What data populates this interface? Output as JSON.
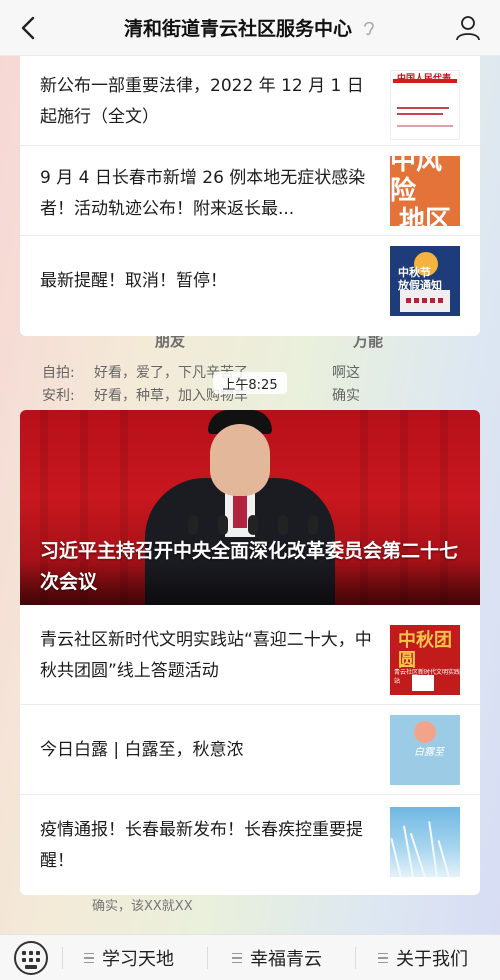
{
  "header": {
    "title": "清和街道青云社区服务中心"
  },
  "background": {
    "col_heads": [
      "朋友",
      "万能"
    ],
    "rows": [
      {
        "label": "自拍:",
        "text": "好看，爱了，下凡辛苦了",
        "right": "啊这"
      },
      {
        "label": "安利:",
        "text": "好看，种草，加入购物车",
        "right": "确实"
      }
    ],
    "bottom_text": "确实，该XX就XX",
    "time": "上午8:25"
  },
  "news_top": [
    {
      "title": "新公布一部重要法律，2022 年 12 月 1 日起施行（全文）",
      "thumb_mast": "中国人民代表",
      "thumb": "document-thumbnail"
    },
    {
      "title": "9 月 4 日长春市新增 26 例本地无症状感染者！活动轨迹公布！附来返长最...",
      "thumb_lines": [
        "中风险",
        "地区"
      ],
      "thumb": "risk-area-thumbnail"
    },
    {
      "title": "最新提醒！取消！暂停！",
      "thumb_lines": [
        "中秋节",
        "放假通知"
      ],
      "thumb": "mid-autumn-notice-thumbnail"
    }
  ],
  "hero": {
    "title": "习近平主持召开中央全面深化改革委员会第二十七次会议"
  },
  "news_bottom": [
    {
      "title": "青云社区新时代文明实践站“喜迎二十大，中秋共团圆”线上答题活动",
      "thumb_text": "中秋团圆",
      "thumb_sub": "青云社区新时代文明实践站",
      "thumb": "mid-autumn-quiz-thumbnail"
    },
    {
      "title": "今日白露 | 白露至，秋意浓",
      "thumb_text": "白露至",
      "thumb": "white-dew-thumbnail"
    },
    {
      "title": "疫情通报！长春最新发布！长春疾控重要提醒！",
      "thumb": "reeds-thumbnail"
    }
  ],
  "bottom_nav": {
    "items": [
      "学习天地",
      "幸福青云",
      "关于我们"
    ]
  },
  "colors": {
    "hero_red": "#c8171f",
    "orange": "#e4733a",
    "navy": "#1e3b7a"
  }
}
